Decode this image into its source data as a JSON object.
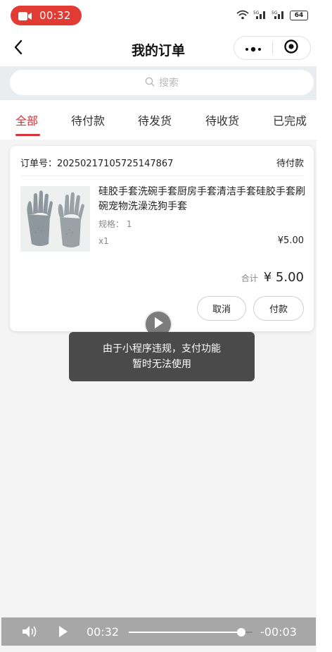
{
  "status_bar": {
    "recording_time": "00:32",
    "signal_1": "₈ᵢl",
    "signal_2": "₈ᵢl",
    "battery": "64"
  },
  "nav": {
    "title": "我的订单"
  },
  "search": {
    "placeholder": "搜索"
  },
  "tabs": [
    {
      "label": "全部",
      "active": true
    },
    {
      "label": "待付款",
      "active": false
    },
    {
      "label": "待发货",
      "active": false
    },
    {
      "label": "待收货",
      "active": false
    },
    {
      "label": "已完成",
      "active": false
    }
  ],
  "order": {
    "order_no": "订单号：20250217105725147867",
    "status": "待付款",
    "product_name": "硅胶手套洗碗手套厨房手套清洁手套硅胶手套刷碗宠物洗澡洗狗手套",
    "spec": "规格：  1",
    "qty": "x1",
    "price": "¥5.00",
    "total_label": "合计",
    "total_value": "¥ 5.00",
    "cancel_label": "取消",
    "pay_label": "付款"
  },
  "toast": {
    "line1": "由于小程序违规，支付功能",
    "line2": "暂时无法使用"
  },
  "video": {
    "current_time": "00:32",
    "remaining_time": "-00:03",
    "progress": 0.91
  },
  "colors": {
    "accent": "#d8323a",
    "record_pill": "#e23b34",
    "toast_bg": "#4a4a4a",
    "video_bar": "#a7a7a7"
  },
  "icons": [
    "back-arrow-icon",
    "more-dots-icon",
    "target-icon",
    "search-icon",
    "play-icon",
    "volume-icon",
    "video-camera-icon",
    "wifi-icon"
  ]
}
